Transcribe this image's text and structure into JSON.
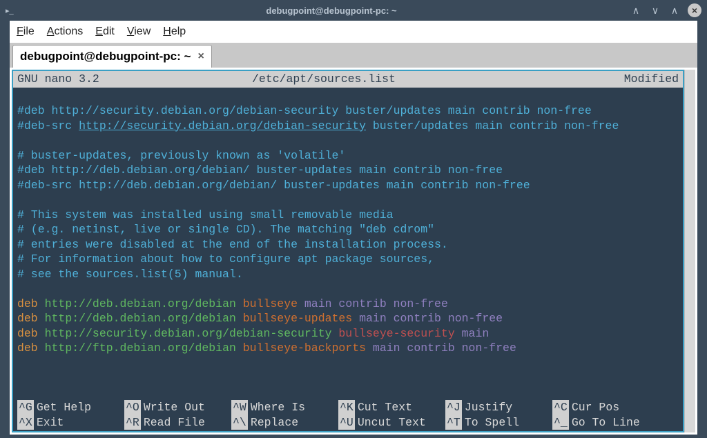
{
  "titlebar": {
    "title": "debugpoint@debugpoint-pc: ~"
  },
  "menubar": {
    "file": "File",
    "actions": "Actions",
    "edit": "Edit",
    "view": "View",
    "help": "Help"
  },
  "tab": {
    "label": "debugpoint@debugpoint-pc: ~",
    "close": "×"
  },
  "nano": {
    "version": "GNU nano 3.2",
    "filename": "/etc/apt/sources.list",
    "status": "Modified",
    "lines": [
      {
        "type": "comment",
        "text": "#deb http://security.debian.org/debian-security buster/updates main contrib non-free"
      },
      {
        "type": "comment-link",
        "prefix": "#deb-src ",
        "link": "http://security.debian.org/debian-security",
        "suffix": " buster/updates main contrib non-free"
      },
      {
        "type": "blank",
        "text": ""
      },
      {
        "type": "comment",
        "text": "# buster-updates, previously known as 'volatile'"
      },
      {
        "type": "comment",
        "text": "#deb http://deb.debian.org/debian/ buster-updates main contrib non-free"
      },
      {
        "type": "comment",
        "text": "#deb-src http://deb.debian.org/debian/ buster-updates main contrib non-free"
      },
      {
        "type": "blank",
        "text": ""
      },
      {
        "type": "comment",
        "text": "# This system was installed using small removable media"
      },
      {
        "type": "comment",
        "text": "# (e.g. netinst, live or single CD). The matching \"deb cdrom\""
      },
      {
        "type": "comment",
        "text": "# entries were disabled at the end of the installation process."
      },
      {
        "type": "comment",
        "text": "# For information about how to configure apt package sources,"
      },
      {
        "type": "comment",
        "text": "# see the sources.list(5) manual."
      },
      {
        "type": "blank",
        "text": ""
      },
      {
        "type": "deb",
        "deb": "deb",
        "url": "http://deb.debian.org/debian",
        "suite": "bullseye",
        "comp": "main contrib non-free"
      },
      {
        "type": "deb",
        "deb": "deb",
        "url": "http://deb.debian.org/debian",
        "suite": "bullseye-updates",
        "comp": "main contrib non-free"
      },
      {
        "type": "deb2",
        "deb": "deb",
        "url": "http://security.debian.org/debian-security",
        "suite": "bullseye-security",
        "comp": "main"
      },
      {
        "type": "deb",
        "deb": "deb",
        "url": "http://ftp.debian.org/debian",
        "suite": "bullseye-backports",
        "comp": "main contrib non-free"
      }
    ],
    "footer": [
      [
        {
          "key": "^G",
          "label": "Get Help"
        },
        {
          "key": "^O",
          "label": "Write Out"
        },
        {
          "key": "^W",
          "label": "Where Is"
        },
        {
          "key": "^K",
          "label": "Cut Text"
        },
        {
          "key": "^J",
          "label": "Justify"
        },
        {
          "key": "^C",
          "label": "Cur Pos"
        }
      ],
      [
        {
          "key": "^X",
          "label": "Exit"
        },
        {
          "key": "^R",
          "label": "Read File"
        },
        {
          "key": "^\\",
          "label": "Replace"
        },
        {
          "key": "^U",
          "label": "Uncut Text"
        },
        {
          "key": "^T",
          "label": "To Spell"
        },
        {
          "key": "^_",
          "label": "Go To Line"
        }
      ]
    ]
  }
}
